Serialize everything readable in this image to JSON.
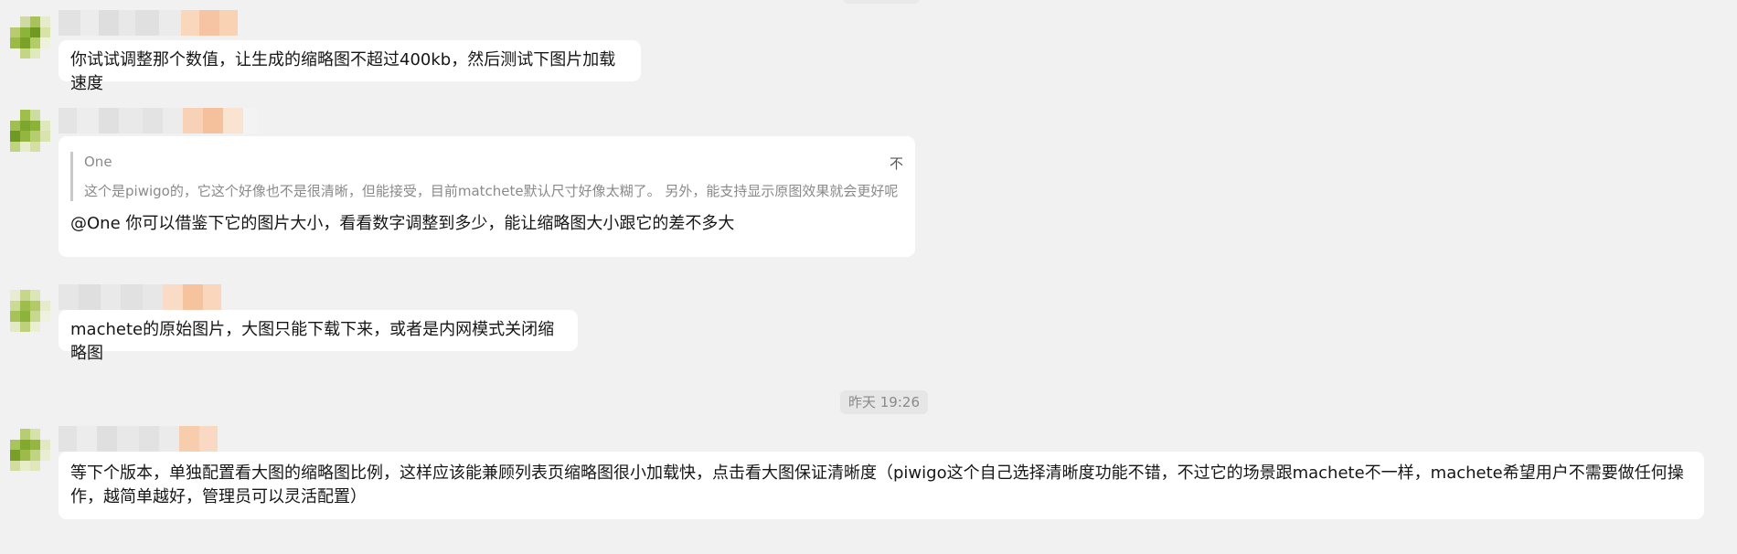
{
  "messages": [
    {
      "text": "你试试调整那个数值，让生成的缩略图不超过400kb，然后测试下图片加载速度"
    },
    {
      "quote": {
        "author": "One",
        "body": "这个是piwigo的，它这个好像也不是很清晰，但能接受，目前matchete默认尺寸好像太糊了。 另外，能支持显示原图效果就会更好呢",
        "more": "不"
      },
      "text": "@One 你可以借鉴下它的图片大小，看看数字调整到多少，能让缩略图大小跟它的差不多大"
    },
    {
      "text": "machete的原始图片，大图只能下载下来，或者是内网模式关闭缩略图"
    },
    {
      "text": "等下个版本，单独配置看大图的缩略图比例，这样应该能兼顾列表页缩略图很小加载快，点击看大图保证清晰度（piwigo这个自己选择清晰度功能不错，不过它的场景跟machete不一样，machete希望用户不需要做任何操作，越简单越好，管理员可以灵活配置）"
    }
  ],
  "timestamp": "昨天 19:26",
  "colors": {
    "background": "#f1f1f1",
    "bubble": "#ffffff",
    "avatar_green": "#8cb33a",
    "name_blur_peach": "#f8c9a6"
  }
}
